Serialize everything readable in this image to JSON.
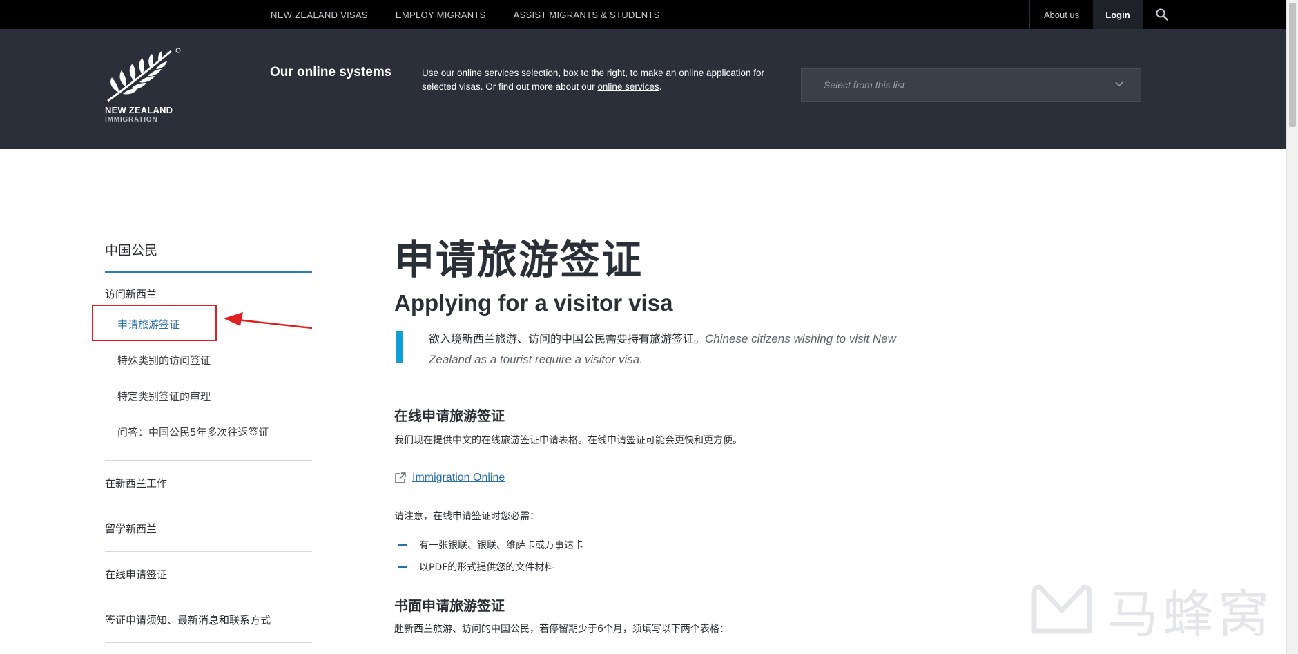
{
  "topnav": {
    "links": [
      "NEW ZEALAND VISAS",
      "EMPLOY MIGRANTS",
      "ASSIST MIGRANTS & STUDENTS"
    ],
    "about": "About us",
    "login": "Login",
    "search_icon": "search-icon"
  },
  "header": {
    "logo_line1": "NEW ZEALAND",
    "logo_line2": "IMMIGRATION",
    "title": "Our online systems",
    "desc_pre": "Use our online services selection, box to the right, to make an online application for selected visas. Or find out more about our ",
    "desc_link": "online services",
    "desc_post": ".",
    "select_placeholder": "Select from this list"
  },
  "sidebar": {
    "heading": "中国公民",
    "group": "访问新西兰",
    "subitems": [
      "申请旅游签证",
      "特殊类别的访问签证",
      "特定类别签证的审理",
      "问答：中国公民5年多次往返签证"
    ],
    "items": [
      "在新西兰工作",
      "留学新西兰",
      "在线申请签证",
      "签证申请须知、最新消息和联系方式"
    ]
  },
  "main": {
    "title_cn": "申请旅游签证",
    "title_en": "Applying for a visitor visa",
    "callout_cn": "欲入境新西兰旅游、访问的中国公民需要持有旅游签证。",
    "callout_en": "Chinese citizens wishing to visit New Zealand as a tourist require a visitor visa.",
    "section1_title": "在线申请旅游签证",
    "section1_text": "我们现在提供中文的在线旅游签证申请表格。在线申请签证可能会更快和更方便。",
    "link_label": "Immigration Online",
    "note": "请注意，在线申请签证时您必需：",
    "bullets": [
      "有一张银联、银联、维萨卡或万事达卡",
      "以PDF的形式提供您的文件材料"
    ],
    "section2_title": "书面申请旅游签证",
    "section2_text": "赴新西兰旅游、访问的中国公民，若停留期少于6个月，须填写以下两个表格："
  },
  "watermark": {
    "text": "马蜂窝"
  },
  "colors": {
    "topbar": "#000000",
    "header": "#2b2f3a",
    "accent_blue": "#2a6fab",
    "callout_bar": "#0e9fd8",
    "annotation_red": "#e02020"
  }
}
